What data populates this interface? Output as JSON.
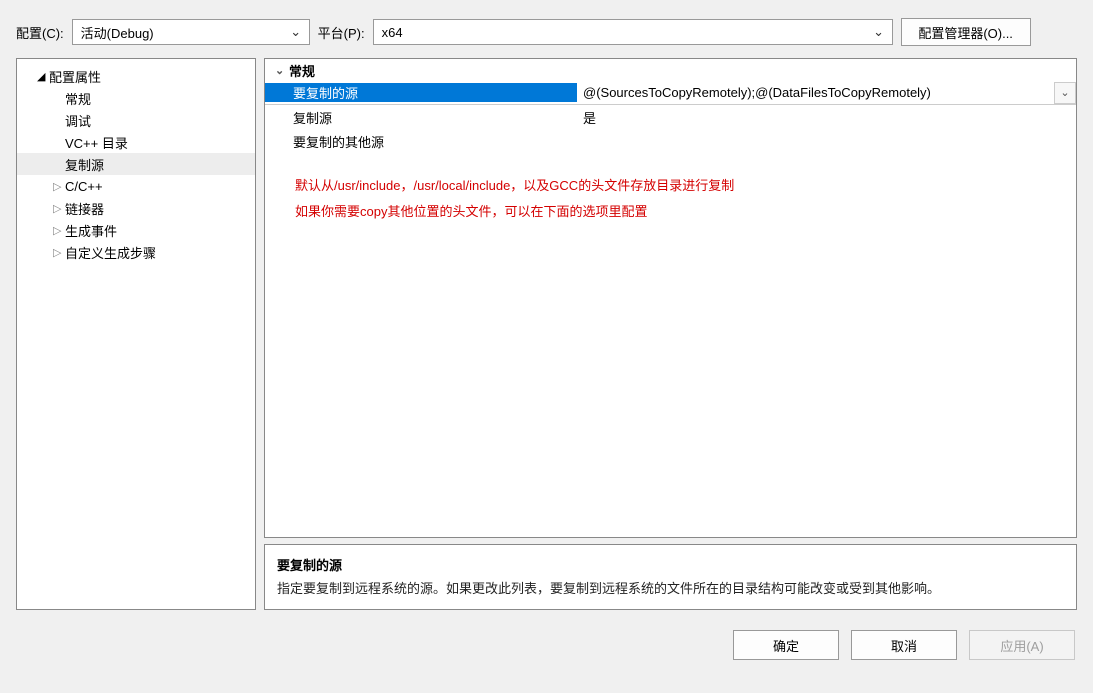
{
  "topbar": {
    "config_label": "配置(C):",
    "config_value": "活动(Debug)",
    "platform_label": "平台(P):",
    "platform_value": "x64",
    "manager_button": "配置管理器(O)..."
  },
  "tree": {
    "root": "配置属性",
    "items": [
      {
        "label": "常规",
        "type": "leaf"
      },
      {
        "label": "调试",
        "type": "leaf"
      },
      {
        "label": "VC++ 目录",
        "type": "leaf"
      },
      {
        "label": "复制源",
        "type": "leaf",
        "selected": true
      },
      {
        "label": "C/C++",
        "type": "branch"
      },
      {
        "label": "链接器",
        "type": "branch"
      },
      {
        "label": "生成事件",
        "type": "branch"
      },
      {
        "label": "自定义生成步骤",
        "type": "branch"
      }
    ]
  },
  "grid": {
    "group": "常规",
    "rows": [
      {
        "name": "要复制的源",
        "value": "@(SourcesToCopyRemotely);@(DataFilesToCopyRemotely)",
        "selected": true,
        "dropdown": true
      },
      {
        "name": "复制源",
        "value": "是"
      },
      {
        "name": "要复制的其他源",
        "value": ""
      }
    ],
    "note_line1": "默认从/usr/include，/usr/local/include，以及GCC的头文件存放目录进行复制",
    "note_line2": "如果你需要copy其他位置的头文件，可以在下面的选项里配置"
  },
  "desc": {
    "title": "要复制的源",
    "body": "指定要复制到远程系统的源。如果更改此列表，要复制到远程系统的文件所在的目录结构可能改变或受到其他影响。"
  },
  "footer": {
    "ok": "确定",
    "cancel": "取消",
    "apply": "应用(A)"
  }
}
